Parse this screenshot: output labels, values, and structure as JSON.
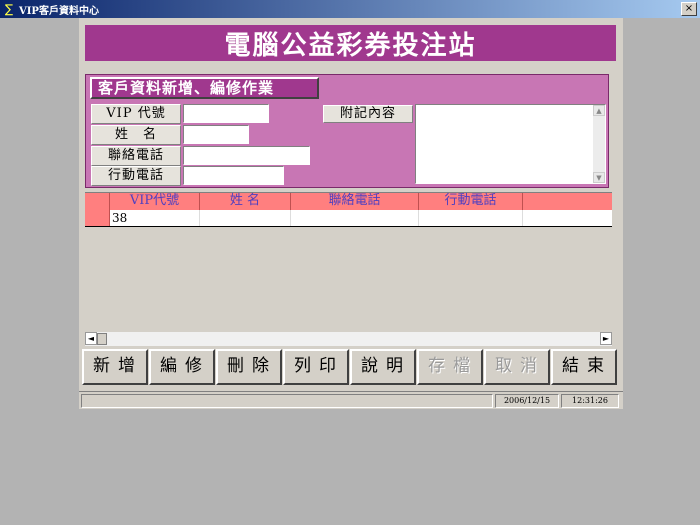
{
  "window": {
    "title": "VIP客戶資料中心",
    "close_glyph": "×"
  },
  "banner": {
    "title": "電腦公益彩券投注站"
  },
  "edit_section": {
    "title": "客戶資料新增、編修作業",
    "fields": [
      {
        "label": "VIP 代號",
        "value": ""
      },
      {
        "label": "姓　名",
        "value": ""
      },
      {
        "label": "聯絡電話",
        "value": ""
      },
      {
        "label": "行動電話",
        "value": ""
      }
    ],
    "note_label": "附記內容",
    "note_value": ""
  },
  "grid": {
    "columns": [
      "VIP代號",
      "姓 名",
      "聯絡電話",
      "行動電話",
      ""
    ],
    "rows": [
      [
        "38",
        "",
        "",
        "",
        ""
      ]
    ]
  },
  "toolbar": {
    "buttons": [
      {
        "label": "新增",
        "enabled": true
      },
      {
        "label": "編修",
        "enabled": true
      },
      {
        "label": "刪除",
        "enabled": true
      },
      {
        "label": "列印",
        "enabled": true
      },
      {
        "label": "說明",
        "enabled": true
      },
      {
        "label": "存檔",
        "enabled": false
      },
      {
        "label": "取消",
        "enabled": false
      },
      {
        "label": "結束",
        "enabled": true
      }
    ]
  },
  "status": {
    "date": "2006/12/15",
    "time": "12:31:26"
  },
  "colors": {
    "banner": "#a0388e",
    "panel": "#c876b4",
    "grid_header": "#ff7f7f",
    "header_text": "#5040c0"
  }
}
